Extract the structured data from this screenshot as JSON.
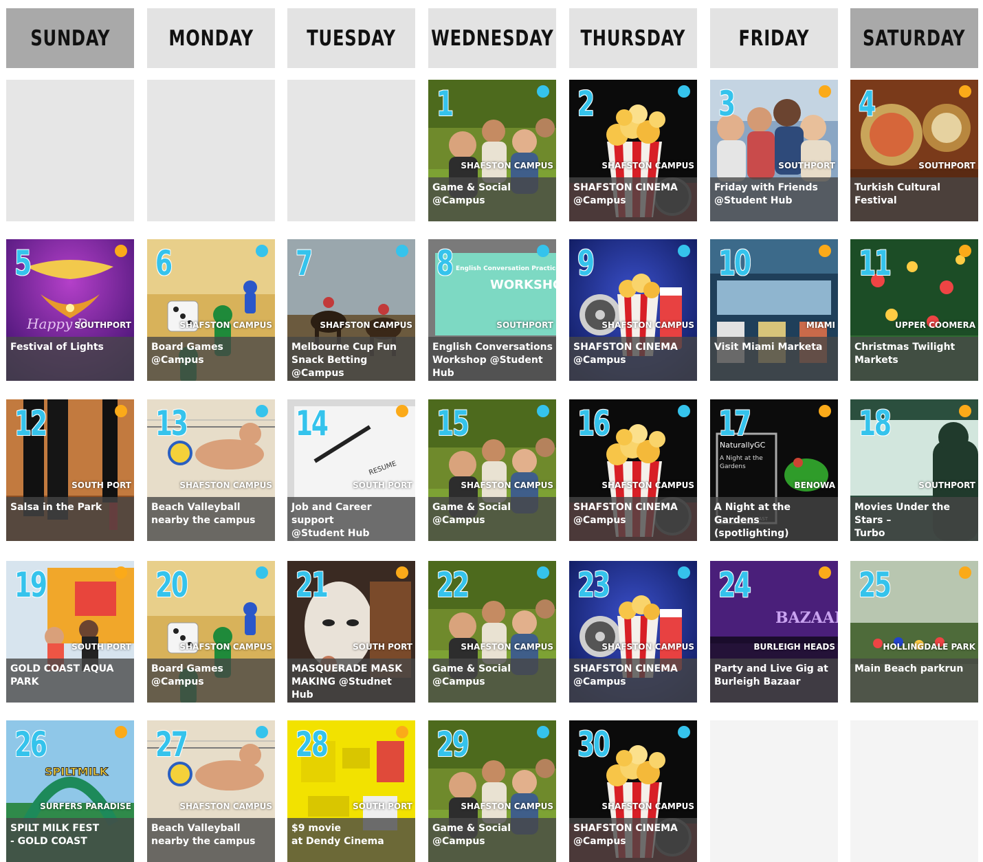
{
  "colors": {
    "dot_blue": "#35c3ec",
    "dot_orange": "#fbaa19",
    "number_blue": "#35c3ec"
  },
  "days": [
    {
      "label": "SUNDAY",
      "shade": "#a9a9a9"
    },
    {
      "label": "MONDAY",
      "shade": "#e3e3e3"
    },
    {
      "label": "TUESDAY",
      "shade": "#e3e3e3"
    },
    {
      "label": "WEDNESDAY",
      "shade": "#e3e3e3"
    },
    {
      "label": "THURSDAY",
      "shade": "#e3e3e3"
    },
    {
      "label": "FRIDAY",
      "shade": "#e3e3e3"
    },
    {
      "label": "SATURDAY",
      "shade": "#a9a9a9"
    }
  ],
  "events": [
    {
      "day": "1",
      "location": "SHAFSTON CAMPUS",
      "title": "Game & Social\n@Campus",
      "dot": "blue",
      "theme": "social"
    },
    {
      "day": "2",
      "location": "SHAFSTON CAMPUS",
      "title": "SHAFSTON CINEMA\n@Campus",
      "dot": "blue",
      "theme": "popcorn"
    },
    {
      "day": "3",
      "location": "SOUTHPORT",
      "title": "Friday with Friends\n@Student Hub",
      "dot": "orange",
      "theme": "friends"
    },
    {
      "day": "4",
      "location": "SOUTHPORT",
      "title": "Turkish Cultural Festival",
      "dot": "orange",
      "theme": "turkish"
    },
    {
      "day": "5",
      "location": "SOUTHPORT",
      "title": "Festival of Lights",
      "dot": "orange",
      "theme": "diwali"
    },
    {
      "day": "6",
      "location": "SHAFSTON CAMPUS",
      "title": "Board Games\n@Campus",
      "dot": "blue",
      "theme": "boardgame"
    },
    {
      "day": "7",
      "location": "SHAFSTON CAMPUS",
      "title": "Melbourne Cup Fun\nSnack Betting @Campus",
      "dot": "blue",
      "theme": "horses"
    },
    {
      "day": "8",
      "location": "SOUTHPORT",
      "title": "English Conversations\nWorkshop @Student Hub",
      "dot": "blue",
      "theme": "workshop"
    },
    {
      "day": "9",
      "location": "SHAFSTON CAMPUS",
      "title": "SHAFSTON CINEMA\n@Campus",
      "dot": "blue",
      "theme": "cinema"
    },
    {
      "day": "10",
      "location": "MIAMI",
      "title": "Visit Miami Marketa",
      "dot": "orange",
      "theme": "market"
    },
    {
      "day": "11",
      "location": "UPPER COOMERA",
      "title": "Christmas Twilight\nMarkets",
      "dot": "orange",
      "theme": "christmas"
    },
    {
      "day": "12",
      "location": "SOUTH PORT",
      "title": "Salsa in the Park",
      "dot": "orange",
      "theme": "salsa"
    },
    {
      "day": "13",
      "location": "SHAFSTON CAMPUS",
      "title": "Beach Valleyball\nnearby the campus",
      "dot": "blue",
      "theme": "volley"
    },
    {
      "day": "14",
      "location": "SOUTH PORT",
      "title": "Job and Career support\n@Student Hub",
      "dot": "orange",
      "theme": "resume"
    },
    {
      "day": "15",
      "location": "SHAFSTON CAMPUS",
      "title": "Game & Social\n@Campus",
      "dot": "blue",
      "theme": "social"
    },
    {
      "day": "16",
      "location": "SHAFSTON CAMPUS",
      "title": "SHAFSTON CINEMA\n@Campus",
      "dot": "blue",
      "theme": "popcorn"
    },
    {
      "day": "17",
      "location": "BENOWA",
      "title": "A Night at the Gardens\n(spotlighting)",
      "dot": "orange",
      "theme": "frog",
      "sign": [
        "NaturallyGC",
        "A Night at the",
        "Gardens",
        "GOLDCOAST"
      ]
    },
    {
      "day": "18",
      "location": "SOUTHPORT",
      "title": "Movies Under the Stars –\nTurbo",
      "dot": "orange",
      "theme": "movies"
    },
    {
      "day": "19",
      "location": "SOUTH PORT",
      "title": "GOLD COAST AQUA PARK",
      "dot": "orange",
      "theme": "aqua"
    },
    {
      "day": "20",
      "location": "SHAFSTON CAMPUS",
      "title": "Board Games\n@Campus",
      "dot": "blue",
      "theme": "boardgame"
    },
    {
      "day": "21",
      "location": "SOUTH PORT",
      "title": "MASQUERADE MASK\nMAKING @Studnet Hub",
      "dot": "orange",
      "theme": "mask"
    },
    {
      "day": "22",
      "location": "SHAFSTON CAMPUS",
      "title": "Game & Social\n@Campus",
      "dot": "blue",
      "theme": "social"
    },
    {
      "day": "23",
      "location": "SHAFSTON CAMPUS",
      "title": "SHAFSTON CINEMA\n@Campus",
      "dot": "blue",
      "theme": "cinema"
    },
    {
      "day": "24",
      "location": "BURLEIGH HEADS",
      "title": "Party and Live Gig at\nBurleigh Bazaar",
      "dot": "orange",
      "theme": "bazaar",
      "sign": [
        "BAZAAR"
      ]
    },
    {
      "day": "25",
      "location": "HOLLINGDALE PARK",
      "title": "Main Beach parkrun",
      "dot": "orange",
      "theme": "parkrun"
    },
    {
      "day": "26",
      "location": "SURFERS PARADISE",
      "title": "SPILT MILK FEST\n- GOLD COAST",
      "dot": "orange",
      "theme": "spiltmilk",
      "sign": [
        "SPILTMILK"
      ]
    },
    {
      "day": "27",
      "location": "SHAFSTON CAMPUS",
      "title": "Beach Valleyball\nnearby the campus",
      "dot": "blue",
      "theme": "volley"
    },
    {
      "day": "28",
      "location": "SOUTH PORT",
      "title": "$9 movie\nat Dendy Cinema",
      "dot": "orange",
      "theme": "dendy"
    },
    {
      "day": "29",
      "location": "SHAFSTON CAMPUS",
      "title": "Game & Social\n@Campus",
      "dot": "blue",
      "theme": "social"
    },
    {
      "day": "30",
      "location": "SHAFSTON CAMPUS",
      "title": "SHAFSTON CINEMA\n@Campus",
      "dot": "blue",
      "theme": "popcorn"
    }
  ]
}
